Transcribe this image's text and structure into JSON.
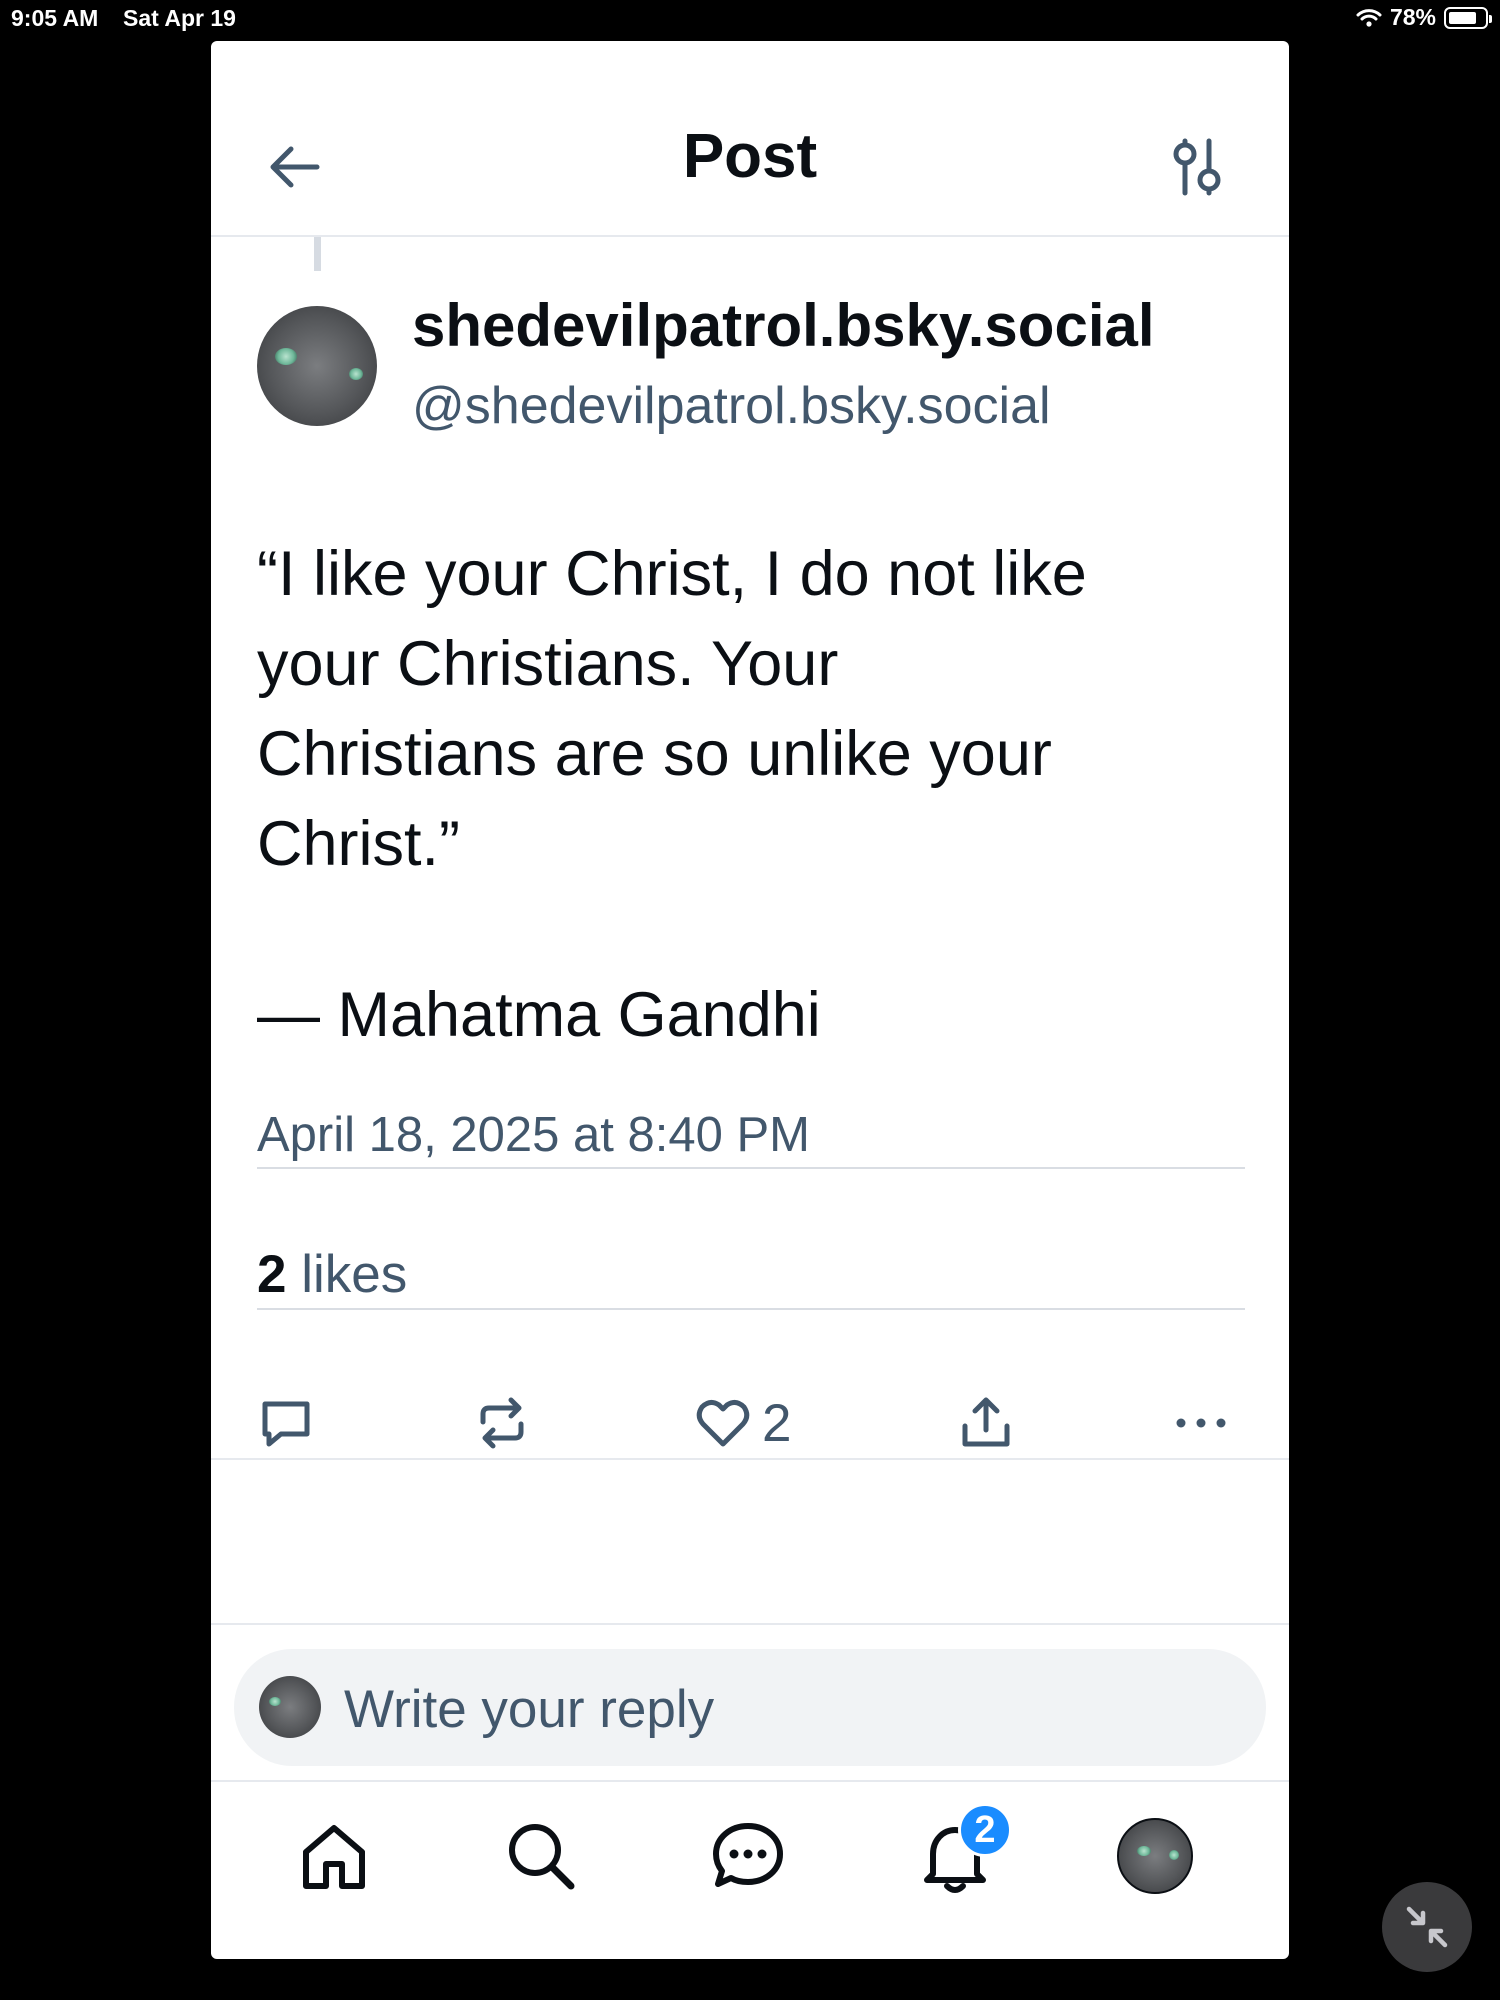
{
  "status_bar": {
    "time": "9:05 AM",
    "date": "Sat Apr 19",
    "battery": "78%",
    "battery_level": 0.78
  },
  "header": {
    "title": "Post",
    "back_icon": "arrow-left-icon",
    "settings_icon": "sliders-icon"
  },
  "post": {
    "display_name": "shedevilpatrol.bsky.social",
    "handle": "@shedevilpatrol.bsky.social",
    "text_lines": [
      "“I like your Christ, I do not like",
      "your Christians. Your",
      "Christians are so unlike your",
      "Christ.”"
    ],
    "attribution": "— Mahatma Gandhi",
    "timestamp": "April 18, 2025 at 8:40 PM",
    "likes_count": "2",
    "likes_label": "likes"
  },
  "actions": {
    "reply_icon": "reply-icon",
    "repost_icon": "repost-icon",
    "like_icon": "heart-icon",
    "like_count": "2",
    "share_icon": "share-icon",
    "more_icon": "more-icon"
  },
  "composer": {
    "placeholder": "Write your reply"
  },
  "tabbar": {
    "items": [
      "home-icon",
      "search-icon",
      "chat-icon",
      "bell-icon",
      "profile-avatar"
    ],
    "notifications_badge": "2"
  },
  "colors": {
    "text": "#0b0f14",
    "muted": "#42576c",
    "accent": "#1a8cff",
    "divider": "#d9dde3"
  }
}
